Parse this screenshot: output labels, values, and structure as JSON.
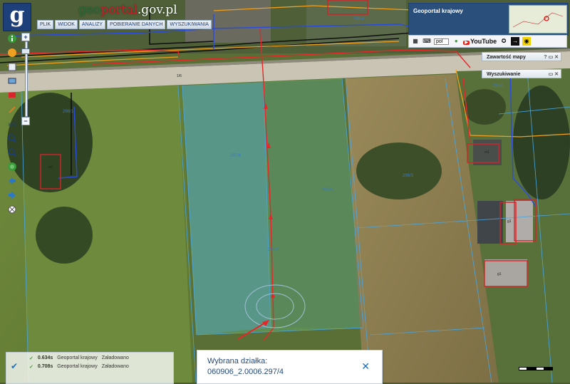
{
  "app": {
    "logo_letter": "g",
    "brand_pre": "geo",
    "brand_mid": "portal",
    "brand_post": ".gov.pl"
  },
  "menu": [
    {
      "label": "PLIK"
    },
    {
      "label": "WIDOK"
    },
    {
      "label": "ANALIZY"
    },
    {
      "label": "POBIERANIE DANYCH"
    },
    {
      "label": "WYSZUKIWANIA"
    }
  ],
  "overview": {
    "title": "Geoportal krajowy"
  },
  "servbar": {
    "language": "pol",
    "youtube": "YouTube"
  },
  "panels": {
    "contents": "Zawartość mapy",
    "contents_ctrls": "? ▭ ✕",
    "search": "Wyszukiwanie",
    "search_ctrls": "▭ ✕"
  },
  "status": {
    "rows": [
      {
        "time": "0.634s",
        "name": "Geoportal krajowy",
        "state": "Załadowano"
      },
      {
        "time": "0.708s",
        "name": "Geoportal krajowy",
        "state": "Załadowano"
      }
    ]
  },
  "selection": {
    "label": "Wybrana działka:",
    "value": "060906_2.0006.297/4"
  },
  "parcel_labels": {
    "p1": "297/4",
    "p2": "297/5",
    "p3": "298/3",
    "p4": "298/2",
    "p5": "298/1",
    "p6": "296/1",
    "p7": "298/4",
    "p8": "1/6"
  },
  "road_labels": {
    "r1": "1/6"
  },
  "building_labels": {
    "b1": "m1",
    "b2": "m1",
    "b3": "g1",
    "b4": "g1"
  },
  "icons": {
    "info": "info-icon",
    "bookmark": "bookmark-icon",
    "layers": "layers-icon",
    "print": "print-icon",
    "screen": "screen-icon",
    "pencil": "pencil-icon",
    "xyz": "xyz-icon",
    "zoom_in": "zoom-in-icon",
    "zoom_out": "zoom-out-icon",
    "globe": "globe-icon",
    "back": "back-arrow-icon",
    "forward": "forward-arrow-icon",
    "clear": "clear-icon"
  }
}
